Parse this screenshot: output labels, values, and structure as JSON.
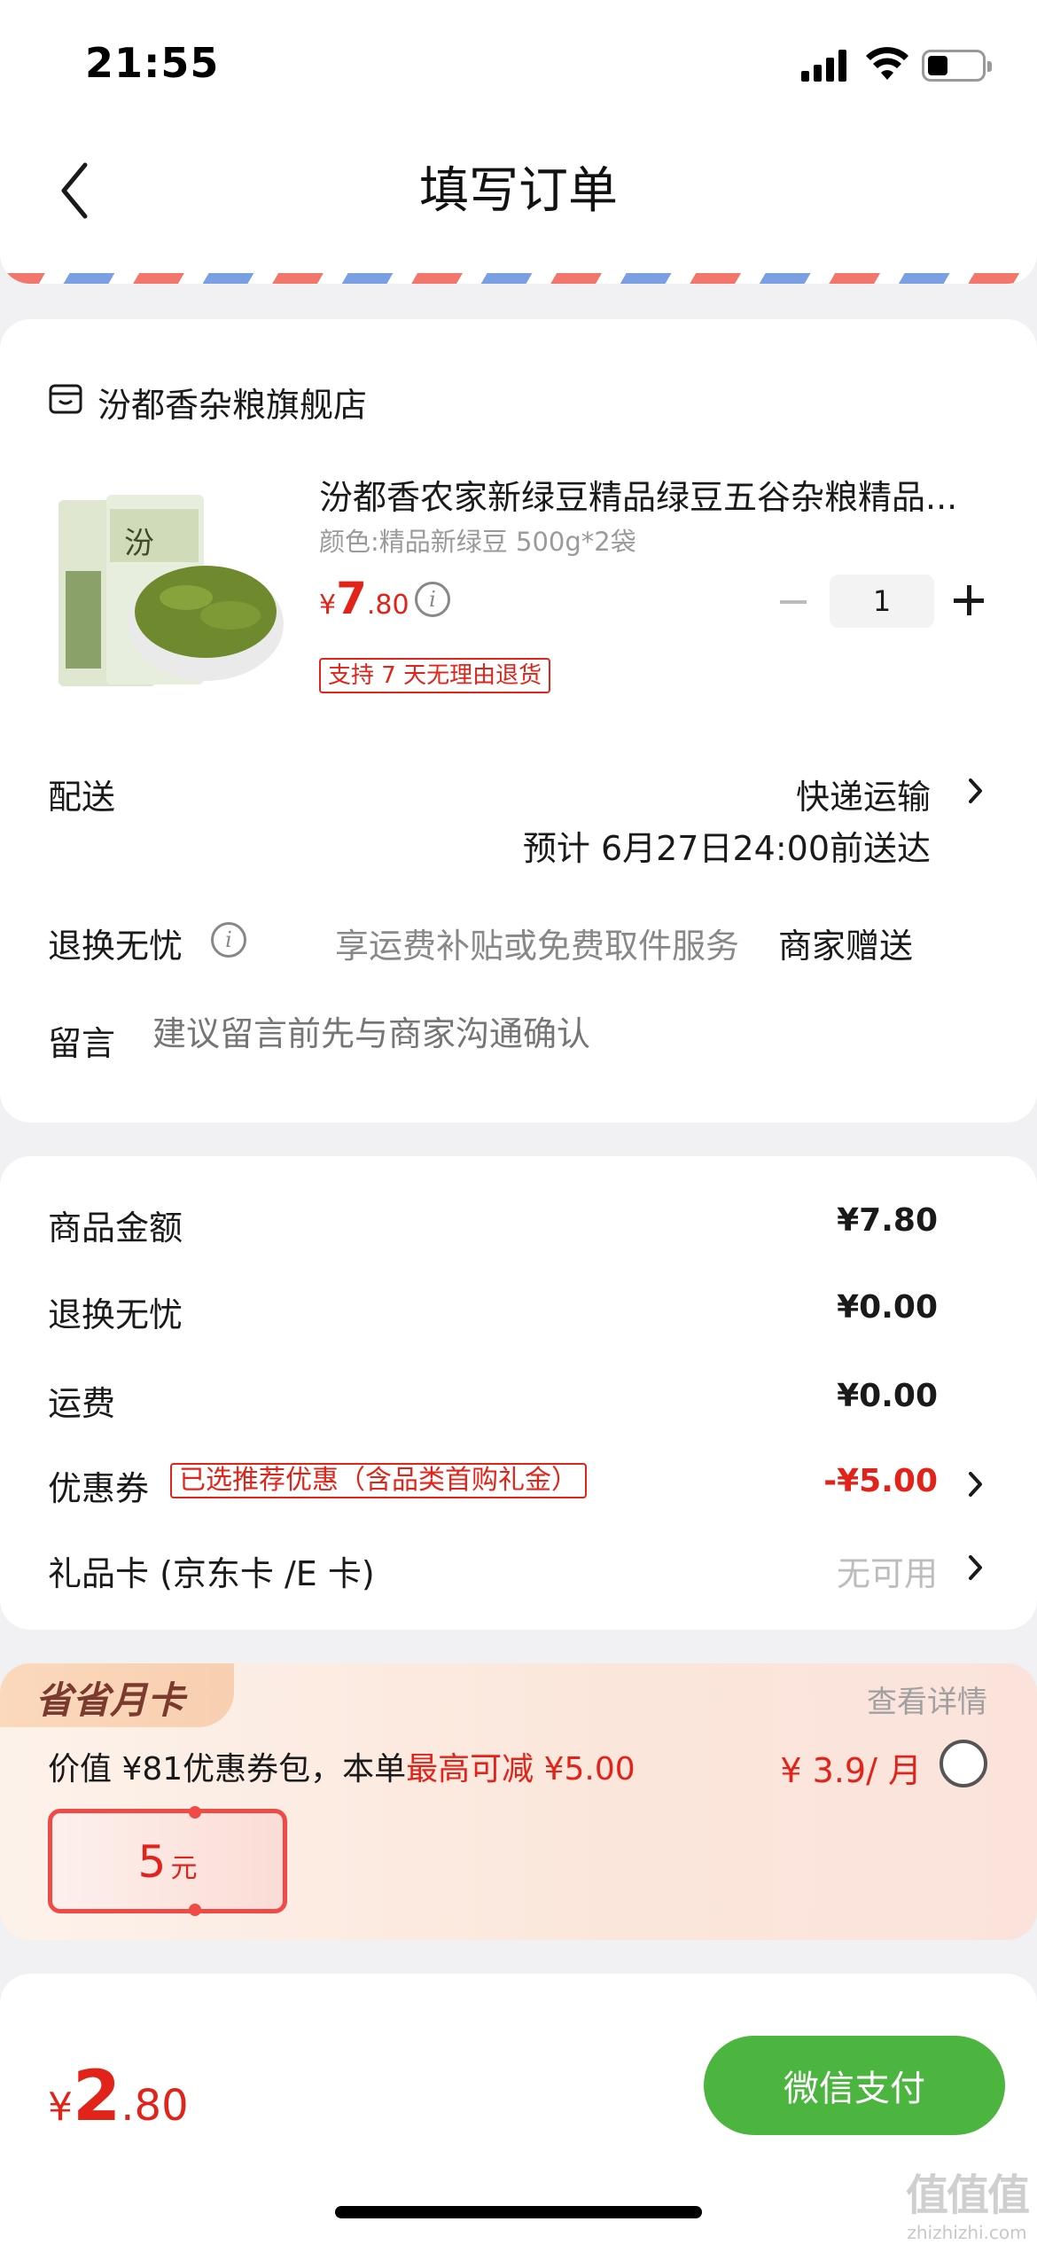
{
  "status_bar": {
    "time": "21:55"
  },
  "nav": {
    "title": "填写订单"
  },
  "store": {
    "name": "汾都香杂粮旗舰店"
  },
  "product": {
    "title": "汾都香农家新绿豆精品绿豆五谷杂粮精品...",
    "variant": "颜色:精品新绿豆 500g*2袋",
    "price_yen": "¥",
    "price_int": "7",
    "price_dec": ".80",
    "quantity": "1",
    "return_tag": "支持 7 天无理由退货"
  },
  "delivery": {
    "label": "配送",
    "method": "快递运输",
    "eta": "预计 6月27日24:00前送达"
  },
  "worry_free": {
    "label": "退换无忧",
    "desc": "享运费补贴或免费取件服务",
    "gift": "商家赠送"
  },
  "message": {
    "label": "留言",
    "placeholder": "建议留言前先与商家沟通确认"
  },
  "price_details": {
    "goods_label": "商品金额",
    "goods_value": "¥7.80",
    "worry_label": "退换无忧",
    "worry_value": "¥0.00",
    "shipping_label": "运费",
    "shipping_value": "¥0.00",
    "coupon_label": "优惠券",
    "coupon_tag": "已选推荐优惠（含品类首购礼金）",
    "coupon_value": "-¥5.00",
    "giftcard_label": "礼品卡 (京东卡 /E 卡)",
    "giftcard_value": "无可用"
  },
  "monthly_card": {
    "badge": "省省月卡",
    "details": "查看详情",
    "desc_prefix": "价值 ¥81优惠券包，本单",
    "desc_highlight": "最高可减 ¥5.00",
    "price": "¥ 3.9/ 月",
    "voucher_num": "5",
    "voucher_unit": "元"
  },
  "checkout": {
    "total_yen": "¥",
    "total_int": "2",
    "total_dec": ".80",
    "pay_label": "微信支付"
  },
  "watermark": {
    "logo": "值值值",
    "url": "zhizhizhi.com"
  },
  "colors": {
    "accent_red": "#e2231a",
    "pay_green": "#4cb540",
    "background": "#f1f1f3"
  }
}
